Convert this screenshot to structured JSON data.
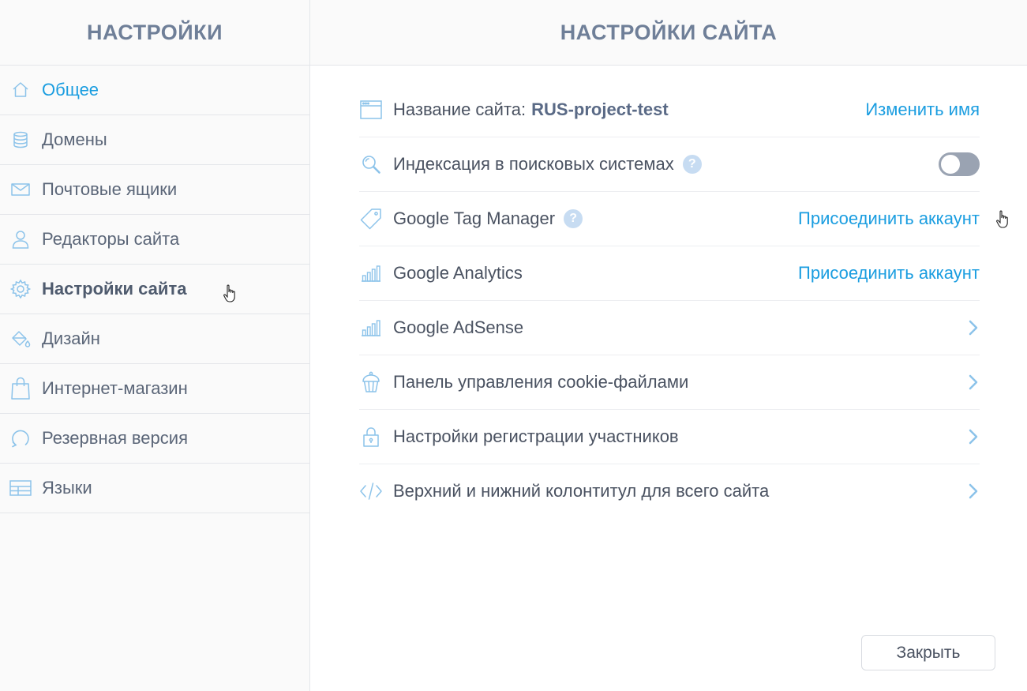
{
  "sidebar": {
    "title": "НАСТРОЙКИ",
    "items": [
      {
        "label": "Общее",
        "icon": "home-icon"
      },
      {
        "label": "Домены",
        "icon": "database-icon"
      },
      {
        "label": "Почтовые ящики",
        "icon": "mail-icon"
      },
      {
        "label": "Редакторы сайта",
        "icon": "user-icon"
      },
      {
        "label": "Настройки сайта",
        "icon": "gear-icon"
      },
      {
        "label": "Дизайн",
        "icon": "paint-bucket-icon"
      },
      {
        "label": "Интернет-магазин",
        "icon": "shopping-bag-icon"
      },
      {
        "label": "Резервная версия",
        "icon": "restore-icon"
      },
      {
        "label": "Языки",
        "icon": "languages-grid-icon"
      }
    ]
  },
  "main": {
    "title": "НАСТРОЙКИ САЙТА",
    "rows": [
      {
        "label": "Название сайта:",
        "value": "RUS-project-test",
        "action": "Изменить имя",
        "icon": "browser-window-icon"
      },
      {
        "label": "Индексация в поисковых системах",
        "help": "?",
        "icon": "search-icon",
        "toggle_on": false
      },
      {
        "label": "Google Tag Manager",
        "help": "?",
        "action": "Присоединить аккаунт",
        "icon": "tag-icon"
      },
      {
        "label": "Google Analytics",
        "action": "Присоединить аккаунт",
        "icon": "bar-chart-icon"
      },
      {
        "label": "Google AdSense",
        "icon": "bar-chart-icon"
      },
      {
        "label": "Панель управления cookie-файлами",
        "icon": "cupcake-icon"
      },
      {
        "label": "Настройки регистрации участников",
        "icon": "lock-icon"
      },
      {
        "label": "Верхний и нижний колонтитул для всего сайта",
        "icon": "code-icon"
      }
    ],
    "close_label": "Закрыть"
  },
  "colors": {
    "accent": "#1a9de0",
    "header_text": "#6f7f98",
    "sidebar_bg": "#fafafa",
    "icon_blue": "#8cc3ea",
    "toggle_off": "#9aa3b2",
    "help_badge": "#c7dcf2"
  }
}
